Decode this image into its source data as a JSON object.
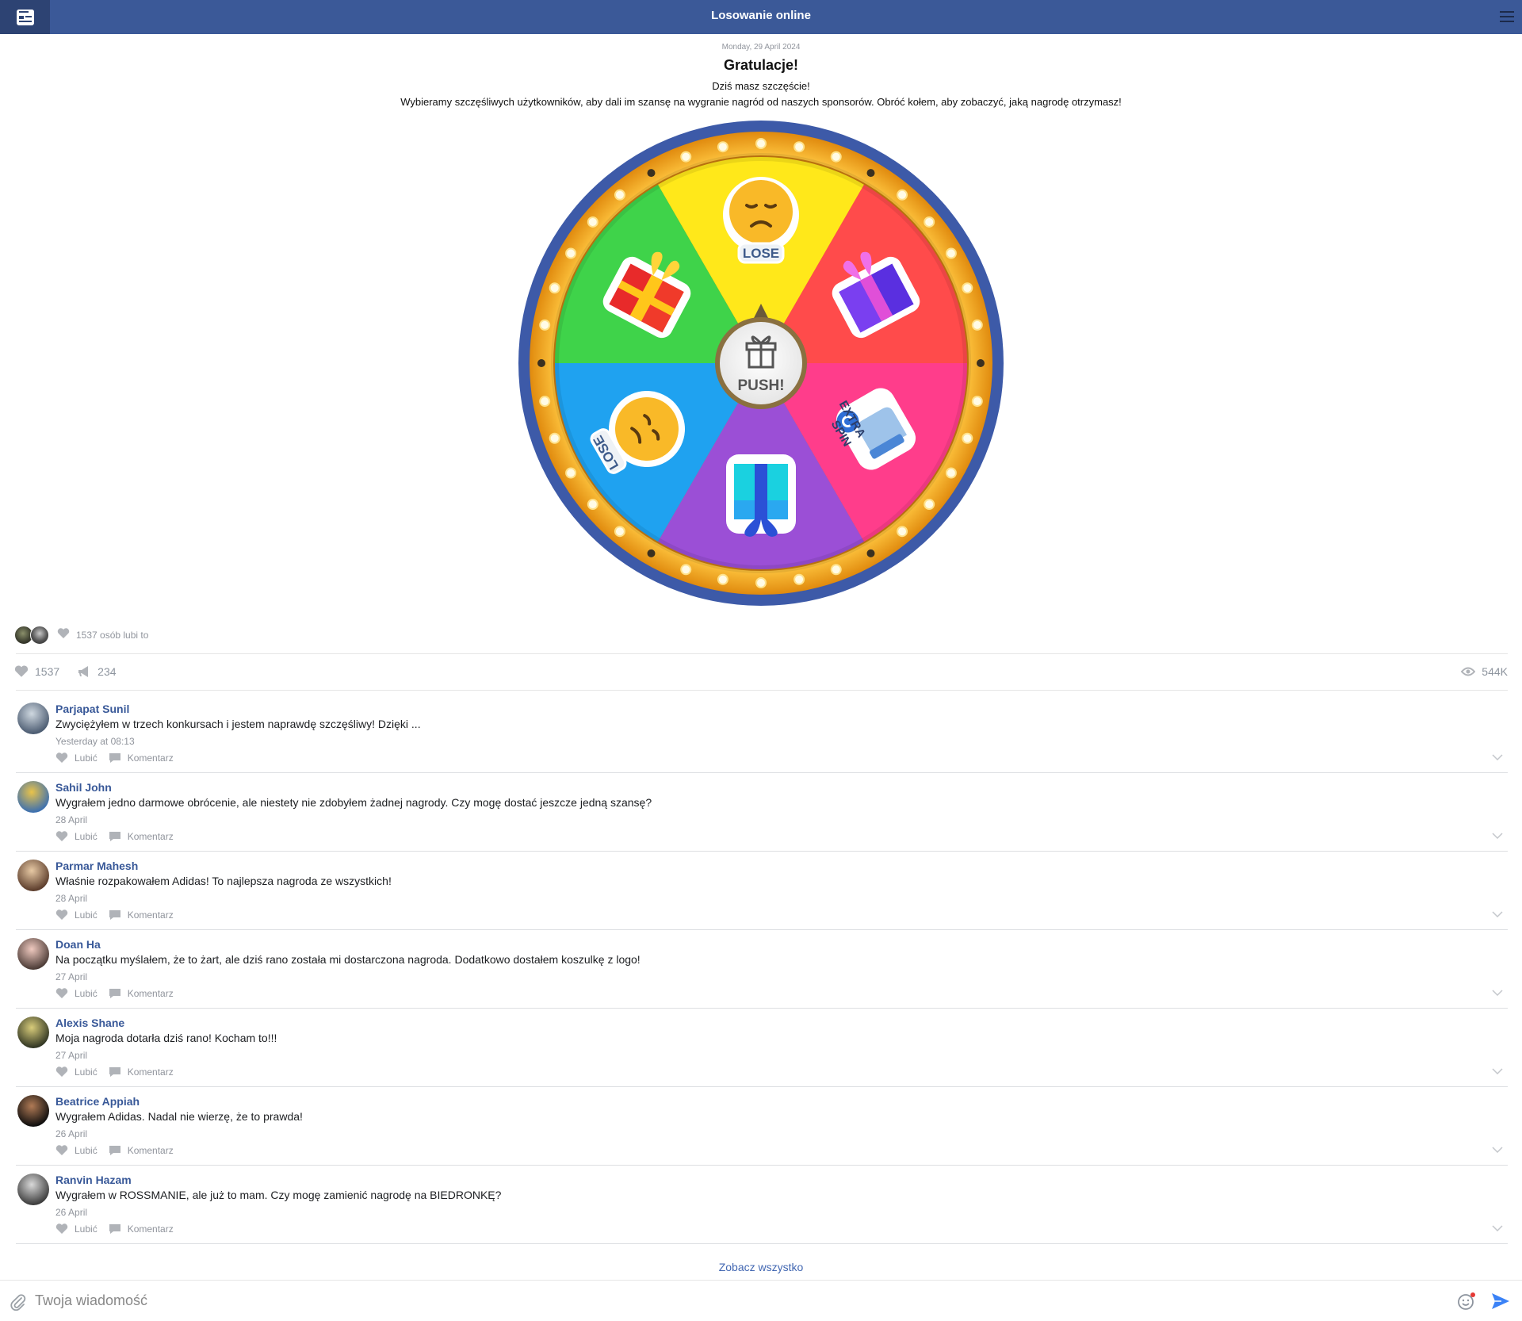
{
  "header": {
    "title": "Losowanie online"
  },
  "post": {
    "date": "Monday, 29 April 2024",
    "headline": "Gratulacje!",
    "subtitle": "Dziś masz szczęście!",
    "description": "Wybieramy szczęśliwych użytkowników, aby dali im szansę na wygranie nagród od naszych sponsorów. Obróć kołem, aby zobaczyć, jaką nagrodę otrzymasz!"
  },
  "wheel": {
    "center_label": "PUSH!",
    "segments": [
      {
        "label": "LOSE",
        "color": "#ffe81a"
      },
      {
        "label": "gift",
        "color": "#ff4b4b"
      },
      {
        "label": "EXTRA SPIN",
        "color": "#ff3d8b"
      },
      {
        "label": "gift",
        "color": "#9b4fd6"
      },
      {
        "label": "LOSE",
        "color": "#1fa2f0"
      },
      {
        "label": "gift",
        "color": "#3fd34a"
      }
    ],
    "rim_color": "#3d5aa8",
    "ring_color": "#f7a11a"
  },
  "reactions": {
    "likes_text": "1537 osób lubi to",
    "likes": "1537",
    "shares": "234",
    "views": "544K"
  },
  "comments": [
    {
      "name": "Parjapat Sunil",
      "text": "Zwyciężyłem w trzech konkursach i jestem naprawdę szczęśliwy! Dzięki ...",
      "time": "Yesterday at 08:13",
      "avatar": [
        "#cfd8e0",
        "#4a5a70"
      ]
    },
    {
      "name": "Sahil John",
      "text": "Wygrałem jedno darmowe obrócenie, ale niestety nie zdobyłem żadnej nagrody. Czy mogę dostać jeszcze jedną szansę?",
      "time": "28 April",
      "avatar": [
        "#e9c34a",
        "#3b6fb0"
      ]
    },
    {
      "name": "Parmar Mahesh",
      "text": "Właśnie rozpakowałem Adidas! To najlepsza nagroda ze wszystkich!",
      "time": "28 April",
      "avatar": [
        "#e7c9a4",
        "#5a3b2a"
      ]
    },
    {
      "name": "Doan Ha",
      "text": "Na początku myślałem, że to żart, ale dziś rano została mi dostarczona nagroda. Dodatkowo dostałem koszulkę z logo!",
      "time": "27 April",
      "avatar": [
        "#efc9bf",
        "#4a3a35"
      ]
    },
    {
      "name": "Alexis Shane",
      "text": "Moja nagroda dotarła dziś rano! Kocham to!!!",
      "time": "27 April",
      "avatar": [
        "#d8cc7a",
        "#2f3422"
      ]
    },
    {
      "name": "Beatrice Appiah",
      "text": "Wygrałem Adidas. Nadal nie wierzę, że to prawda!",
      "time": "26 April",
      "avatar": [
        "#b07a55",
        "#0d0d0d"
      ]
    },
    {
      "name": "Ranvin Hazam",
      "text": "Wygrałem w ROSSMANIE, ale już to mam. Czy mogę zamienić nagrodę na BIEDRONKĘ?",
      "time": "26 April",
      "avatar": [
        "#d9d9d9",
        "#3a3a3a"
      ]
    }
  ],
  "comment_actions": {
    "like": "Lubić",
    "comment": "Komentarz"
  },
  "see_all": "Zobacz wszystko",
  "message_input": {
    "placeholder": "Twoja wiadomość"
  }
}
